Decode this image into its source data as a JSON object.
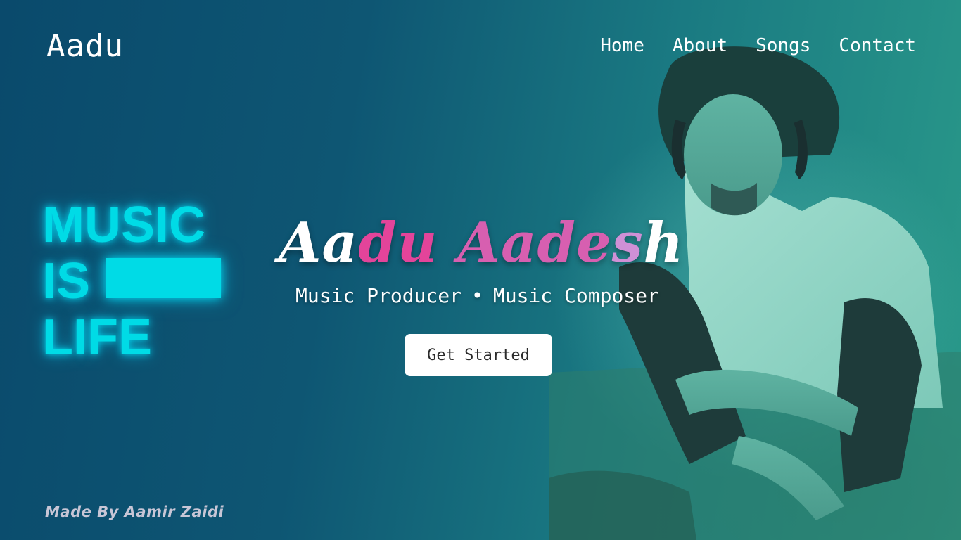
{
  "brand": "Aadu",
  "nav": {
    "items": [
      "Home",
      "About",
      "Songs",
      "Contact"
    ]
  },
  "neon_sign": {
    "line1": "MUSIC",
    "line2": "IS",
    "line3": "LIFE"
  },
  "hero": {
    "title_part1": "Aa",
    "title_part2": "du ",
    "title_part3": "Aade",
    "title_part4": "s",
    "title_part5": "h",
    "subtitle_left": "Music Producer",
    "subtitle_sep": "•",
    "subtitle_right": "Music Composer",
    "cta_label": "Get Started"
  },
  "footer": {
    "credit": "Made By Aamir Zaidi"
  },
  "colors": {
    "accent_neon": "#00dbe6",
    "title_pink": "#e3449a",
    "title_lavender": "#d090d6",
    "bg_dark_blue": "#0a4a6c",
    "bg_teal": "#2a9a8a"
  }
}
